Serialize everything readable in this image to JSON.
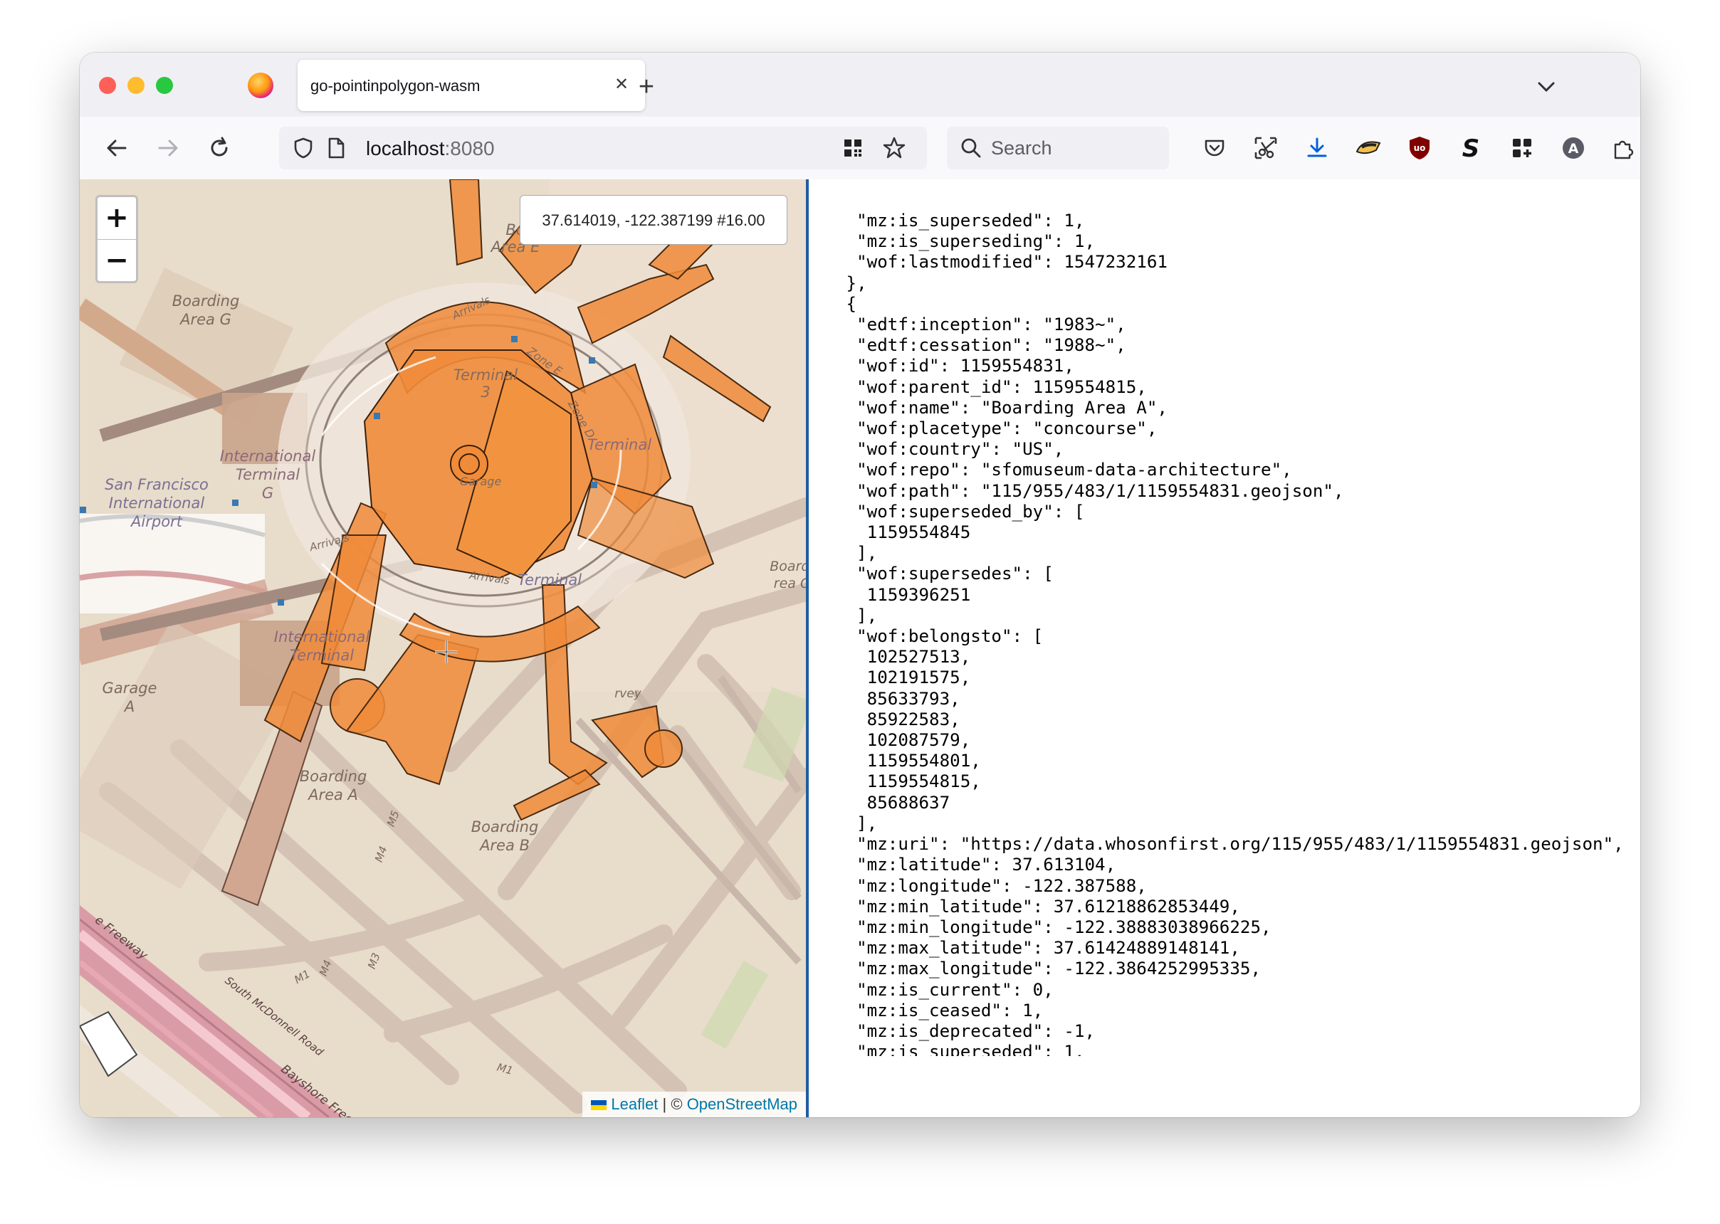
{
  "browser": {
    "tab_title": "go-pointinpolygon-wasm",
    "url_host": "localhost",
    "url_port": ":8080",
    "search_placeholder": "Search"
  },
  "map": {
    "zoom_in_label": "+",
    "zoom_out_label": "−",
    "coordinates": "37.614019, -122.387199 #16.00",
    "attribution": {
      "leaflet": "Leaflet",
      "separator": " | © ",
      "osm": "OpenStreetMap"
    },
    "labels": {
      "boarding_area_g": [
        "Boarding",
        "Area G"
      ],
      "boarding_area_top": [
        "Bo",
        "Area E"
      ],
      "terminal_3": [
        "Terminal",
        "3"
      ],
      "zone_e": "Zone E",
      "zone_d": "Zone D",
      "international_terminal_g": [
        "International",
        "Terminal",
        "G"
      ],
      "sfo": [
        "San Francisco",
        "International",
        "Airport"
      ],
      "garage": "Garage",
      "terminal_right": "Terminal",
      "terminal_bottom": "Terminal",
      "arrivals_1": "Arrivals",
      "arrivals_2": "Arrivals",
      "arrivals_3": "Arrivals",
      "boarding_right": [
        "Boardi",
        "rea C"
      ],
      "international_terminal": [
        "International",
        "Terminal"
      ],
      "garage_a": [
        "Garage",
        "A"
      ],
      "boarding_area_a": [
        "Boarding",
        "Area A"
      ],
      "boarding_area_b": [
        "Boarding",
        "Area B"
      ],
      "harvey": "rvey",
      "freeway": "e Freeway",
      "mcdonnell": "South McDonnell Road",
      "bayshore": "Bayshore Free",
      "road_m1": "M1",
      "road_m1b": "M1",
      "road_m3": "M3",
      "road_m4": "M4",
      "road_m4b": "M4",
      "road_m5": "M5"
    }
  },
  "json_lines": [
    "  \"mz:is_superseded\": 1,",
    "  \"mz:is_superseding\": 1,",
    "  \"wof:lastmodified\": 1547232161",
    " },",
    " {",
    "  \"edtf:inception\": \"1983~\",",
    "  \"edtf:cessation\": \"1988~\",",
    "  \"wof:id\": 1159554831,",
    "  \"wof:parent_id\": 1159554815,",
    "  \"wof:name\": \"Boarding Area A\",",
    "  \"wof:placetype\": \"concourse\",",
    "  \"wof:country\": \"US\",",
    "  \"wof:repo\": \"sfomuseum-data-architecture\",",
    "  \"wof:path\": \"115/955/483/1/1159554831.geojson\",",
    "  \"wof:superseded_by\": [",
    "   1159554845",
    "  ],",
    "  \"wof:supersedes\": [",
    "   1159396251",
    "  ],",
    "  \"wof:belongsto\": [",
    "   102527513,",
    "   102191575,",
    "   85633793,",
    "   85922583,",
    "   102087579,",
    "   1159554801,",
    "   1159554815,",
    "   85688637",
    "  ],",
    "  \"mz:uri\": \"https://data.whosonfirst.org/115/955/483/1/1159554831.geojson\",",
    "  \"mz:latitude\": 37.613104,",
    "  \"mz:longitude\": -122.387588,",
    "  \"mz:min_latitude\": 37.61218862853449,",
    "  \"mz:min_longitude\": -122.38883038966225,",
    "  \"mz:max_latitude\": 37.61424889148141,",
    "  \"mz:max_longitude\": -122.3864252995335,",
    "  \"mz:is_current\": 0,",
    "  \"mz:is_ceased\": 1,",
    "  \"mz:is_deprecated\": -1,",
    "  \"mz:is_superseded\": 1,",
    "  \"mz:is_superseding\": 1"
  ]
}
